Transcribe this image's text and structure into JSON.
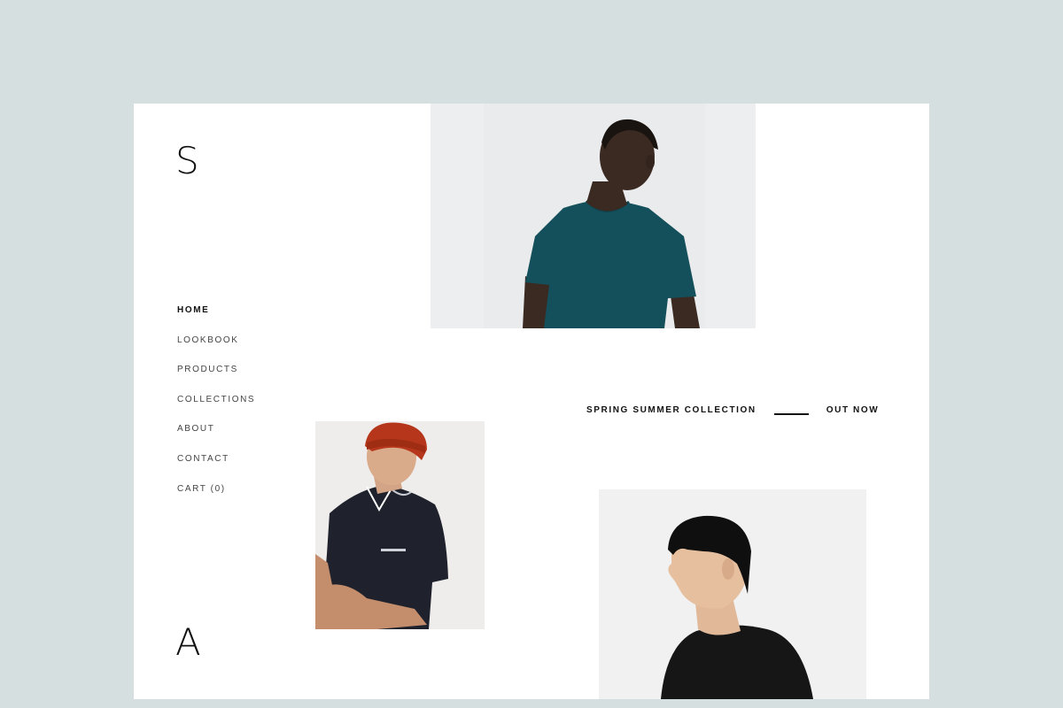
{
  "brand": {
    "logo_top": "S",
    "logo_bottom": "A"
  },
  "nav": {
    "items": [
      {
        "label": "HOME",
        "active": true
      },
      {
        "label": "LOOKBOOK"
      },
      {
        "label": "PRODUCTS"
      },
      {
        "label": "COLLECTIONS"
      },
      {
        "label": "ABOUT"
      },
      {
        "label": "CONTACT"
      },
      {
        "label": "CART (0)"
      }
    ]
  },
  "promo": {
    "title": "SPRING SUMMER COLLECTION",
    "cta": "OUT NOW"
  },
  "colors": {
    "background": "#d6dfe0",
    "page": "#ffffff",
    "text": "#111111"
  }
}
